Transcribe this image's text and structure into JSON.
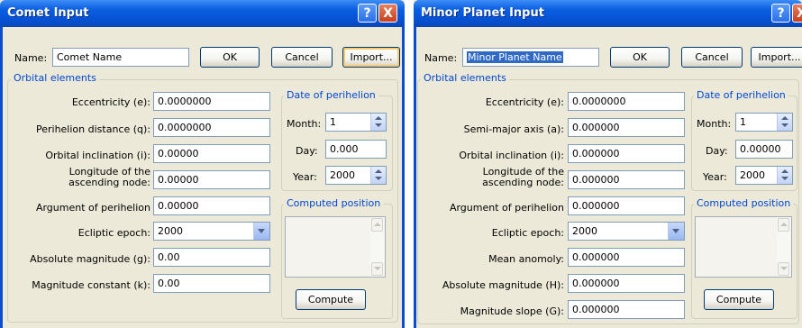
{
  "comet": {
    "title": "Comet Input",
    "help_label": "?",
    "close_label": "X",
    "name_label": "Name:",
    "name_value": "Comet Name",
    "ok_label": "OK",
    "cancel_label": "Cancel",
    "import_label": "Import...",
    "orbital_title": "Orbital elements",
    "eccentricity_label": "Eccentricity (e):",
    "eccentricity_value": "0.0000000",
    "perihelion_distance_label": "Perihelion distance (q):",
    "perihelion_distance_value": "0.0000000",
    "inclination_label": "Orbital inclination (i):",
    "inclination_value": "0.00000",
    "longitude_label_1": "Longitude of the",
    "longitude_label_2": "ascending node:",
    "longitude_value": "0.00000",
    "arg_perihelion_label": "Argument of perihelion",
    "arg_perihelion_value": "0.00000",
    "epoch_label": "Ecliptic epoch:",
    "epoch_value": "2000",
    "abs_mag_label": "Absolute magnitude (g):",
    "abs_mag_value": "0.00",
    "mag_const_label": "Magnitude constant (k):",
    "mag_const_value": "0.00",
    "date_title": "Date of perihelion",
    "month_label": "Month:",
    "month_value": "1",
    "day_label": "Day:",
    "day_value": "0.000",
    "year_label": "Year:",
    "year_value": "2000",
    "computed_title": "Computed position",
    "compute_label": "Compute"
  },
  "minor": {
    "title": "Minor Planet Input",
    "help_label": "?",
    "close_label": "X",
    "name_label": "Name:",
    "name_value": "Minor Planet Name",
    "ok_label": "OK",
    "cancel_label": "Cancel",
    "import_label": "Import...",
    "orbital_title": "Orbital elements",
    "eccentricity_label": "Eccentricity (e):",
    "eccentricity_value": "0.0000000",
    "semi_major_label": "Semi-major axis (a):",
    "semi_major_value": "0.000000",
    "inclination_label": "Orbital inclination (i):",
    "inclination_value": "0.000000",
    "longitude_label_1": "Longitude of the",
    "longitude_label_2": "ascending node:",
    "longitude_value": "0.000000",
    "arg_perihelion_label": "Argument of perihelion",
    "arg_perihelion_value": "0.000000",
    "epoch_label": "Ecliptic epoch:",
    "epoch_value": "2000",
    "mean_anomoly_label": "Mean anomoly:",
    "mean_anomoly_value": "0.000000",
    "abs_mag_label": "Absolute magnitude (H):",
    "abs_mag_value": "0.000000",
    "mag_slope_label": "Magnitude slope (G):",
    "mag_slope_value": "0.000000",
    "date_title": "Date of perihelion",
    "month_label": "Month:",
    "month_value": "1",
    "day_label": "Day:",
    "day_value": "0.00000",
    "year_label": "Year:",
    "year_value": "2000",
    "computed_title": "Computed position",
    "compute_label": "Compute"
  },
  "colors": {
    "titlebar": "#0652d6",
    "dialog_bg": "#ece9d8",
    "group_title": "#0046d5",
    "field_border": "#7f9db9",
    "selection": "#316ac5"
  }
}
